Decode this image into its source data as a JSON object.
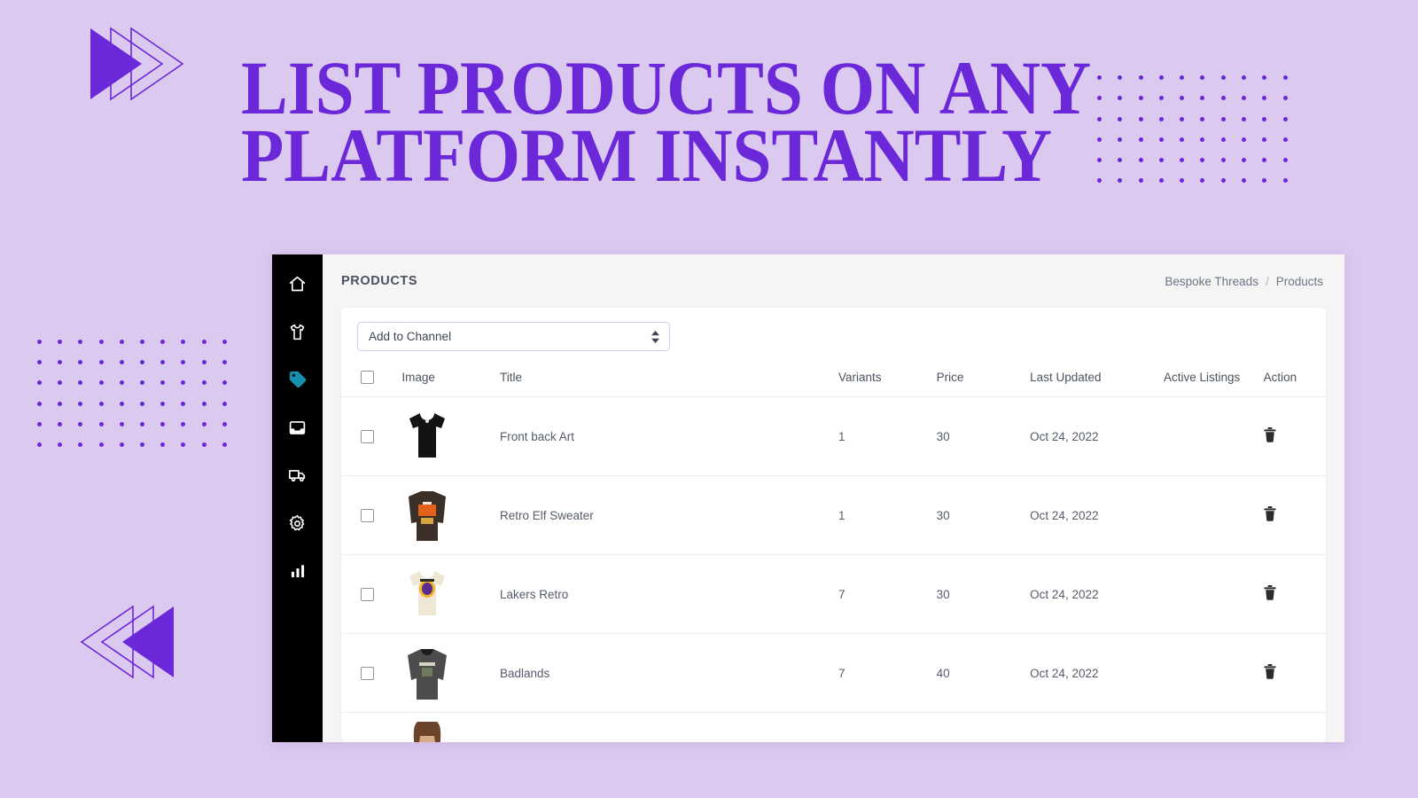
{
  "poster": {
    "background_color": "#dcc9f0",
    "accent_color": "#6b28d9",
    "headline_line1": "LIST PRODUCTS ON ANY",
    "headline_line2": "PLATFORM INSTANTLY"
  },
  "app": {
    "sidebar": {
      "active_color": "#1790b0",
      "items": [
        {
          "icon": "home-icon",
          "label": "Home"
        },
        {
          "icon": "tshirt-icon",
          "label": "Products"
        },
        {
          "icon": "tag-icon",
          "label": "Listings"
        },
        {
          "icon": "inbox-icon",
          "label": "Inbox"
        },
        {
          "icon": "truck-icon",
          "label": "Shipping"
        },
        {
          "icon": "gear-icon",
          "label": "Settings"
        },
        {
          "icon": "bar-chart-icon",
          "label": "Analytics"
        }
      ]
    },
    "header": {
      "title": "PRODUCTS",
      "breadcrumb": {
        "store": "Bespoke Threads",
        "separator": "/",
        "current": "Products"
      }
    },
    "toolbar": {
      "channel_select_value": "Add to Channel",
      "channel_select_options": [
        "Add to Channel"
      ]
    },
    "table": {
      "columns": [
        "",
        "Image",
        "Title",
        "Variants",
        "Price",
        "Last Updated",
        "Active Listings",
        "Action"
      ],
      "select_all_checked": false,
      "action_icon": "trash-icon",
      "rows": [
        {
          "checked": false,
          "image": "black-tshirt-thumbnail",
          "title": "Front back Art",
          "variants": "1",
          "price": "30",
          "last_updated": "Oct 24, 2022",
          "active_listings": "",
          "action": "Delete"
        },
        {
          "checked": false,
          "image": "brown-graphic-sweater-thumbnail",
          "title": "Retro Elf Sweater",
          "variants": "1",
          "price": "30",
          "last_updated": "Oct 24, 2022",
          "active_listings": "",
          "action": "Delete"
        },
        {
          "checked": false,
          "image": "cream-lakers-tshirt-thumbnail",
          "title": "Lakers Retro",
          "variants": "7",
          "price": "30",
          "last_updated": "Oct 24, 2022",
          "active_listings": "",
          "action": "Delete"
        },
        {
          "checked": false,
          "image": "gray-badlands-hoodie-thumbnail",
          "title": "Badlands",
          "variants": "7",
          "price": "40",
          "last_updated": "Oct 24, 2022",
          "active_listings": "",
          "action": "Delete"
        },
        {
          "checked": false,
          "image": "model-wearing-dark-top-thumbnail",
          "title": "",
          "variants": "",
          "price": "",
          "last_updated": "",
          "active_listings": "",
          "action": ""
        }
      ]
    }
  }
}
